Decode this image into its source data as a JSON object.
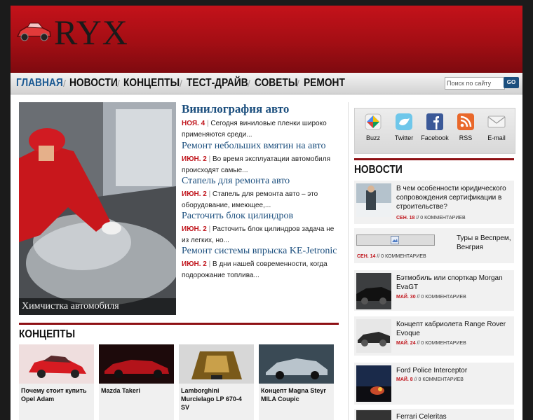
{
  "logo": {
    "text": "RYX"
  },
  "nav": {
    "items": [
      "ГЛАВНАЯ",
      "НОВОСТИ",
      "КОНЦЕПТЫ",
      "ТЕСТ-ДРАЙВ",
      "СОВЕТЫ",
      "РЕМОНТ"
    ],
    "separator": "/"
  },
  "search": {
    "placeholder": "Поиск по сайту",
    "button": "GO"
  },
  "featured": {
    "caption": "Химчистка автомобиля"
  },
  "articles": [
    {
      "title": "Винилография авто",
      "date": "НОЯ. 4",
      "sep": "|",
      "excerpt": "Сегодня виниловые пленки широко применяются среди..."
    },
    {
      "title": "Ремонт небольших вмятин на авто",
      "date": "ИЮН. 2",
      "sep": "|",
      "excerpt": "Во время эксплуатации автомобиля происходят самые..."
    },
    {
      "title": "Стапель для ремонта авто",
      "date": "ИЮН. 2",
      "sep": "|",
      "excerpt": "Стапель для ремонта авто – это оборудование, имеющее,..."
    },
    {
      "title": "Расточить блок цилиндров",
      "date": "ИЮН. 2",
      "sep": "|",
      "excerpt": "Расточить блок цилиндров задача не из легких, но..."
    },
    {
      "title": "Ремонт системы впрыска KE-Jetronic",
      "date": "ИЮН. 2",
      "sep": "|",
      "excerpt": "В дни нашей современности, когда подорожание топлива..."
    }
  ],
  "concepts": {
    "title": "КОНЦЕПТЫ",
    "items": [
      {
        "label": "Почему стоит купить Opel Adam"
      },
      {
        "label": "Mazda Takeri"
      },
      {
        "label": "Lamborghini Murcielago LP 670-4 SV"
      },
      {
        "label": "Концепт Magna Steyr MILA Coupic"
      }
    ]
  },
  "social": [
    {
      "label": "Buzz",
      "icon": "buzz-icon",
      "color": "#e8e8e8"
    },
    {
      "label": "Twitter",
      "icon": "twitter-icon",
      "color": "#6fc7ea"
    },
    {
      "label": "Facebook",
      "icon": "facebook-icon",
      "color": "#3b5998"
    },
    {
      "label": "RSS",
      "icon": "rss-icon",
      "color": "#e9682b"
    },
    {
      "label": "E-mail",
      "icon": "email-icon",
      "color": "#eeeeee"
    }
  ],
  "news": {
    "title": "НОВОСТИ",
    "items": [
      {
        "title": "В чем особенности юридического сопровождения сертификации в строительстве?",
        "date": "СЕН. 18",
        "comments": "0 КОММЕНТАРИЕВ",
        "sep": "//"
      },
      {
        "title": "Туры в Веспрем, Венгрия",
        "date": "СЕН. 14",
        "comments": "0 КОММЕНТАРИЕВ",
        "sep": "//"
      },
      {
        "title": "Бэтмобиль или спорткар Morgan EvaGT",
        "date": "МАЙ. 30",
        "comments": "0 КОММЕНТАРИЕВ",
        "sep": "//"
      },
      {
        "title": "Концепт кабриолета Range Rover Evoque",
        "date": "МАЙ. 24",
        "comments": "0 КОММЕНТАРИЕВ",
        "sep": "//"
      },
      {
        "title": "Ford Police Interceptor",
        "date": "МАЙ. 8",
        "comments": "0 КОММЕНТАРИЕВ",
        "sep": "//"
      },
      {
        "title": "Ferrari Celeritas",
        "date": "",
        "comments": "",
        "sep": ""
      }
    ]
  },
  "colors": {
    "brand_red": "#a30e14",
    "link_blue": "#1c4f7e",
    "date_red": "#c0151c"
  }
}
